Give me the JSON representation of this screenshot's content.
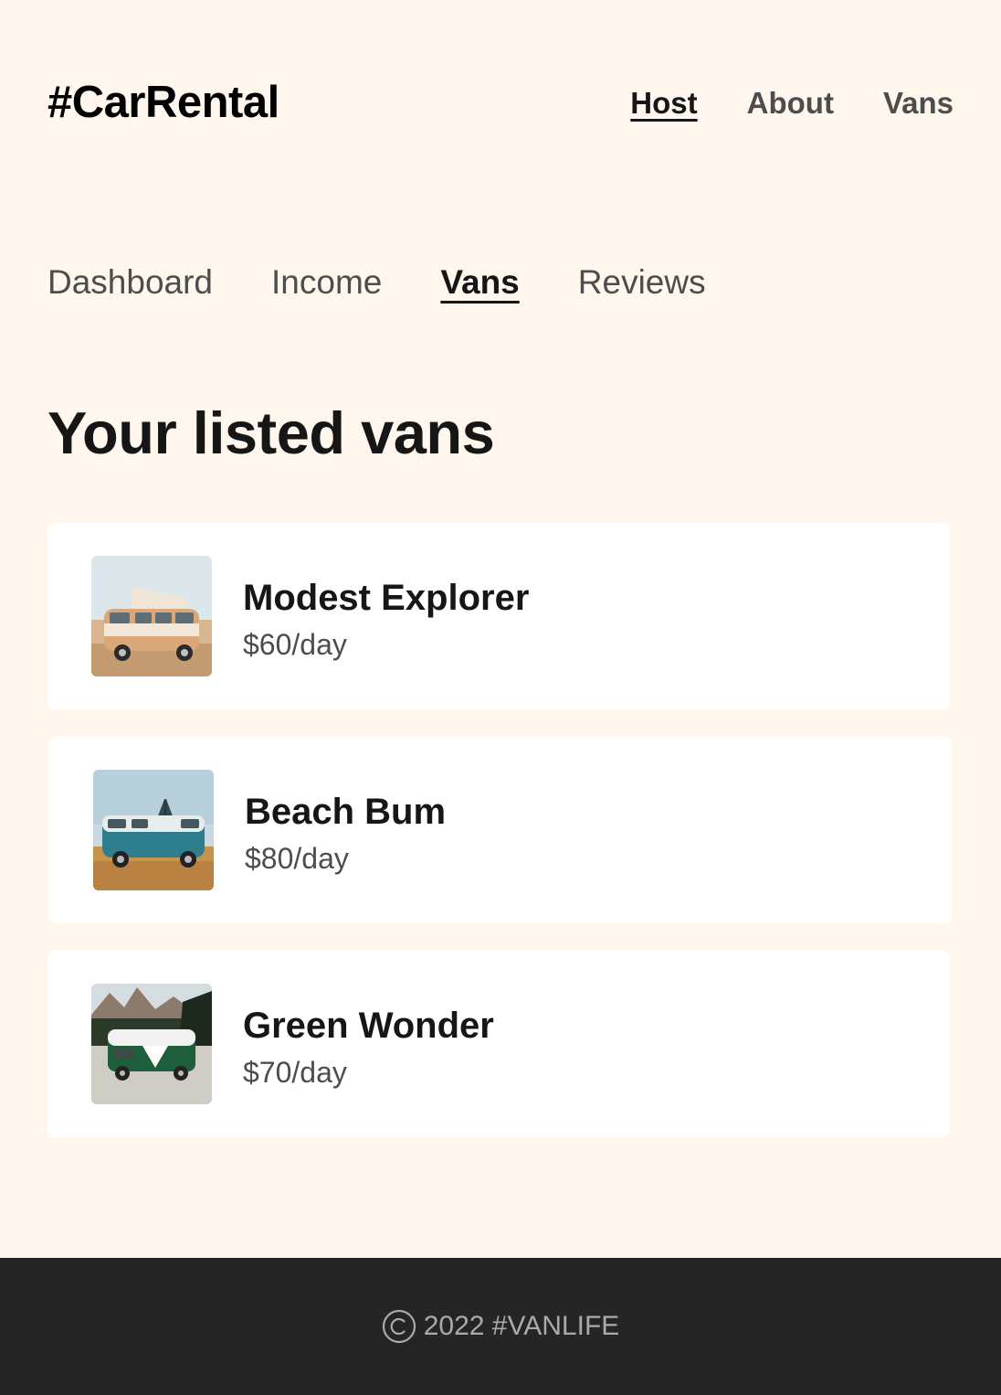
{
  "header": {
    "logo": "#CarRental",
    "nav": [
      {
        "label": "Host",
        "active": true
      },
      {
        "label": "About",
        "active": false
      },
      {
        "label": "Vans",
        "active": false
      }
    ]
  },
  "host_nav": [
    {
      "label": "Dashboard",
      "active": false
    },
    {
      "label": "Income",
      "active": false
    },
    {
      "label": "Vans",
      "active": true
    },
    {
      "label": "Reviews",
      "active": false
    }
  ],
  "page_title": "Your listed vans",
  "vans": [
    {
      "name": "Modest Explorer",
      "price": "$60/day",
      "image": "beige-camper-van-photo"
    },
    {
      "name": "Beach Bum",
      "price": "$80/day",
      "image": "teal-camper-van-beach-photo"
    },
    {
      "name": "Green Wonder",
      "price": "$70/day",
      "image": "green-white-van-mountains-photo"
    }
  ],
  "footer": {
    "icon": "copyright-icon",
    "text": "2022 #VANLIFE"
  },
  "colors": {
    "background": "#FFF7ED",
    "card": "#FFFFFF",
    "text_primary": "#161616",
    "text_secondary": "#4D4D4D",
    "footer_bg": "#252525",
    "footer_text": "#AAAAAA"
  }
}
